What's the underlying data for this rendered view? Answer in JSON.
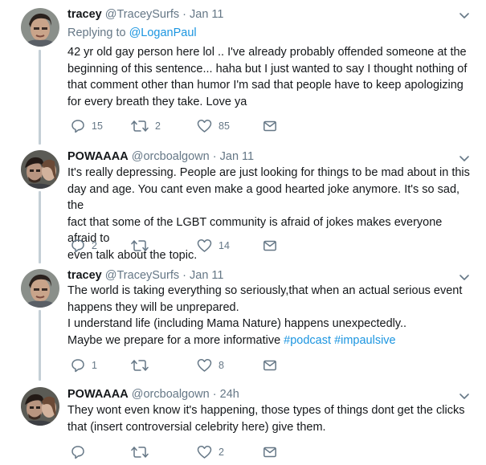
{
  "tweets": [
    {
      "name": "tracey",
      "handle": "@TraceySurfs",
      "separator": "·",
      "time": "Jan 11",
      "replying_prefix": "Replying to ",
      "replying_to": "@LoganPaul",
      "text_lines": [
        "42 yr old gay person here lol .. I've already probably offended someone at the",
        "beginning of this sentence... haha but I just wanted to say I thought nothing of",
        "that comment other than humor I'm sad that people have to keep apologizing",
        "for every breath they take. Love ya"
      ],
      "replies": "15",
      "retweets": "2",
      "likes": "85"
    },
    {
      "name": "POWAAAA",
      "handle": "@orcboalgown",
      "separator": "·",
      "time": "Jan 11",
      "text_lines": [
        "It's really depressing. People are just looking for things to be mad about in this",
        "day and age. You cant even make a good hearted joke anymore. It's so sad, the",
        "fact that some of the LGBT community is afraid of jokes makes everyone afraid to",
        "even talk about the topic."
      ],
      "replies": "2",
      "retweets": "",
      "likes": "14"
    },
    {
      "name": "tracey",
      "handle": "@TraceySurfs",
      "separator": "·",
      "time": "Jan 11",
      "text_lines": [
        "The world is taking everything so seriously,that when an actual serious event",
        "happens they will be unprepared.",
        "I understand life (including Mama Nature) happens unexpectedly..",
        "Maybe we prepare for a more informative "
      ],
      "hashtags": [
        "#podcast",
        "#impaulsive"
      ],
      "replies": "1",
      "retweets": "",
      "likes": "8"
    },
    {
      "name": "POWAAAA",
      "handle": "@orcboalgown",
      "separator": "·",
      "time": "24h",
      "text_lines": [
        "They wont even know it's happening, those types of things dont get the clicks",
        "that (insert controversial celebrity here) give them."
      ],
      "replies": "",
      "retweets": "",
      "likes": "2"
    }
  ],
  "icons": {
    "reply": "reply-icon",
    "retweet": "retweet-icon",
    "like": "heart-icon",
    "dm": "envelope-icon",
    "more": "chevron-down-icon"
  },
  "colors": {
    "link": "#1b95e0",
    "muted": "#657786",
    "thread_line": "#c4cfd6"
  }
}
